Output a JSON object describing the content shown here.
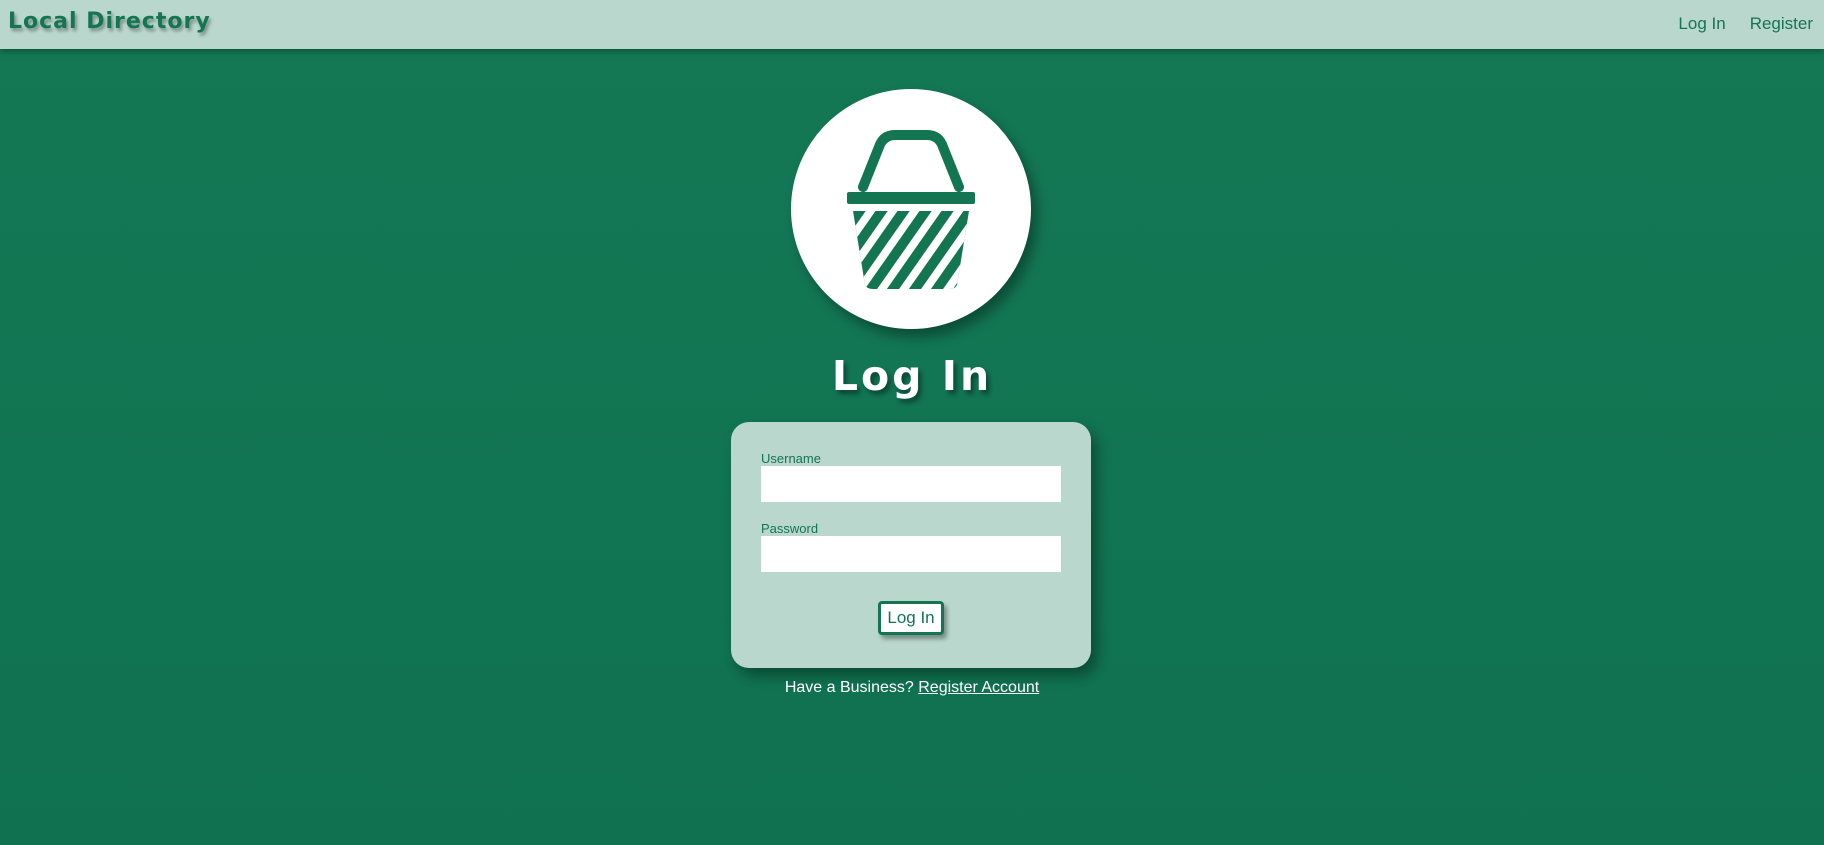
{
  "colors": {
    "primary_green": "#147553",
    "background_green": "#117452",
    "light_mint": "#b9d7cd",
    "white": "#ffffff"
  },
  "navbar": {
    "brand": "Local Directory",
    "links": [
      {
        "label": "Log In"
      },
      {
        "label": "Register"
      }
    ]
  },
  "logo": {
    "icon": "shopping-basket-icon"
  },
  "page": {
    "title": "Log In"
  },
  "form": {
    "username_label": "Username",
    "username_value": "",
    "password_label": "Password",
    "password_value": "",
    "submit_label": "Log In"
  },
  "footer": {
    "prompt": "Have a Business?",
    "link_label": "Register Account"
  }
}
